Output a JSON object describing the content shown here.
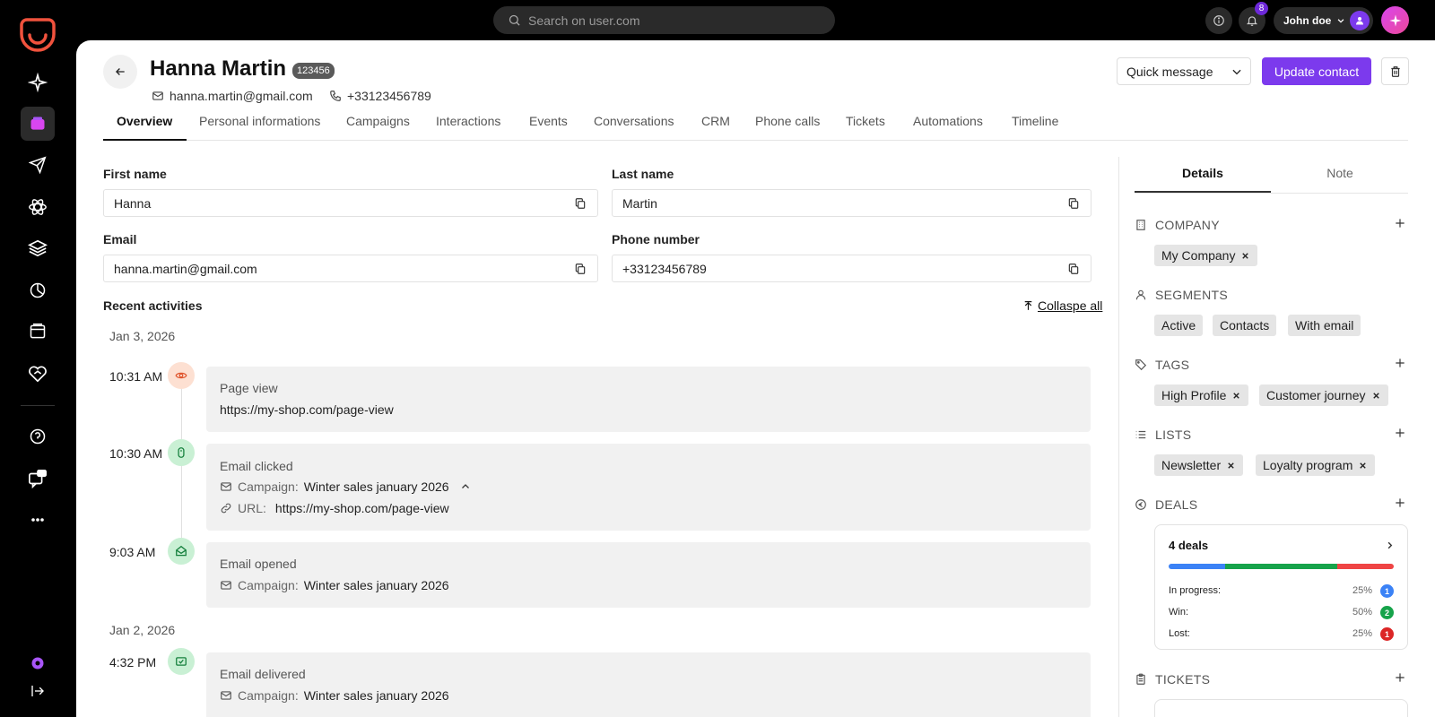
{
  "topbar": {
    "search_placeholder": "Search on user.com",
    "notifications_count": "8",
    "user_name": "John doe"
  },
  "contact": {
    "name": "Hanna Martin",
    "id": "123456",
    "email": "hanna.martin@gmail.com",
    "phone": "+33123456789"
  },
  "actions": {
    "quick_message": "Quick message",
    "update_contact": "Update contact"
  },
  "tabs": [
    "Overview",
    "Personal informations",
    "Campaigns",
    "Interactions",
    "Events",
    "Conversations",
    "CRM",
    "Phone calls",
    "Tickets",
    "Automations",
    "Timeline"
  ],
  "form": {
    "first_name_label": "First name",
    "first_name": "Hanna",
    "last_name_label": "Last name",
    "last_name": "Martin",
    "email_label": "Email",
    "email": "hanna.martin@gmail.com",
    "phone_label": "Phone number",
    "phone": "+33123456789"
  },
  "activities": {
    "title": "Recent activities",
    "collapse_label": "Collaspe all",
    "date1": "Jan 3, 2026",
    "date2": "Jan 2, 2026",
    "items": [
      {
        "time": "10:31 AM",
        "title": "Page view",
        "url": "https://my-shop.com/page-view"
      },
      {
        "time": "10:30 AM",
        "title": "Email clicked",
        "campaign_label": "Campaign:",
        "campaign": "Winter sales january 2026",
        "url_label": "URL:",
        "url": "https://my-shop.com/page-view"
      },
      {
        "time": "9:03 AM",
        "title": "Email opened",
        "campaign_label": "Campaign:",
        "campaign": "Winter sales january 2026"
      },
      {
        "time": "4:32 PM",
        "title": "Email delivered",
        "campaign_label": "Campaign:",
        "campaign": "Winter sales january 2026"
      }
    ]
  },
  "right_panel": {
    "tabs": [
      "Details",
      "Note"
    ],
    "company": {
      "title": "COMPANY",
      "chips": [
        "My Company"
      ]
    },
    "segments": {
      "title": "SEGMENTS",
      "chips": [
        "Active",
        "Contacts",
        "With email"
      ]
    },
    "tags": {
      "title": "TAGS",
      "chips": [
        "High Profile",
        "Customer journey"
      ]
    },
    "lists": {
      "title": "LISTS",
      "chips": [
        "Newsletter",
        "Loyalty program"
      ]
    },
    "deals": {
      "title": "DEALS",
      "count_label": "4 deals",
      "rows": [
        {
          "label": "In progress:",
          "pct": "25%",
          "count": "1",
          "color": "#3b82f6"
        },
        {
          "label": "Win:",
          "pct": "50%",
          "count": "2",
          "color": "#16a34a"
        },
        {
          "label": "Lost:",
          "pct": "25%",
          "count": "1",
          "color": "#dc2626"
        }
      ]
    },
    "tickets": {
      "title": "TICKETS"
    }
  },
  "colors": {
    "accent": "#7c3aed",
    "deal_progress": "#3b82f6",
    "deal_win": "#16a34a",
    "deal_lost": "#ef4444"
  }
}
